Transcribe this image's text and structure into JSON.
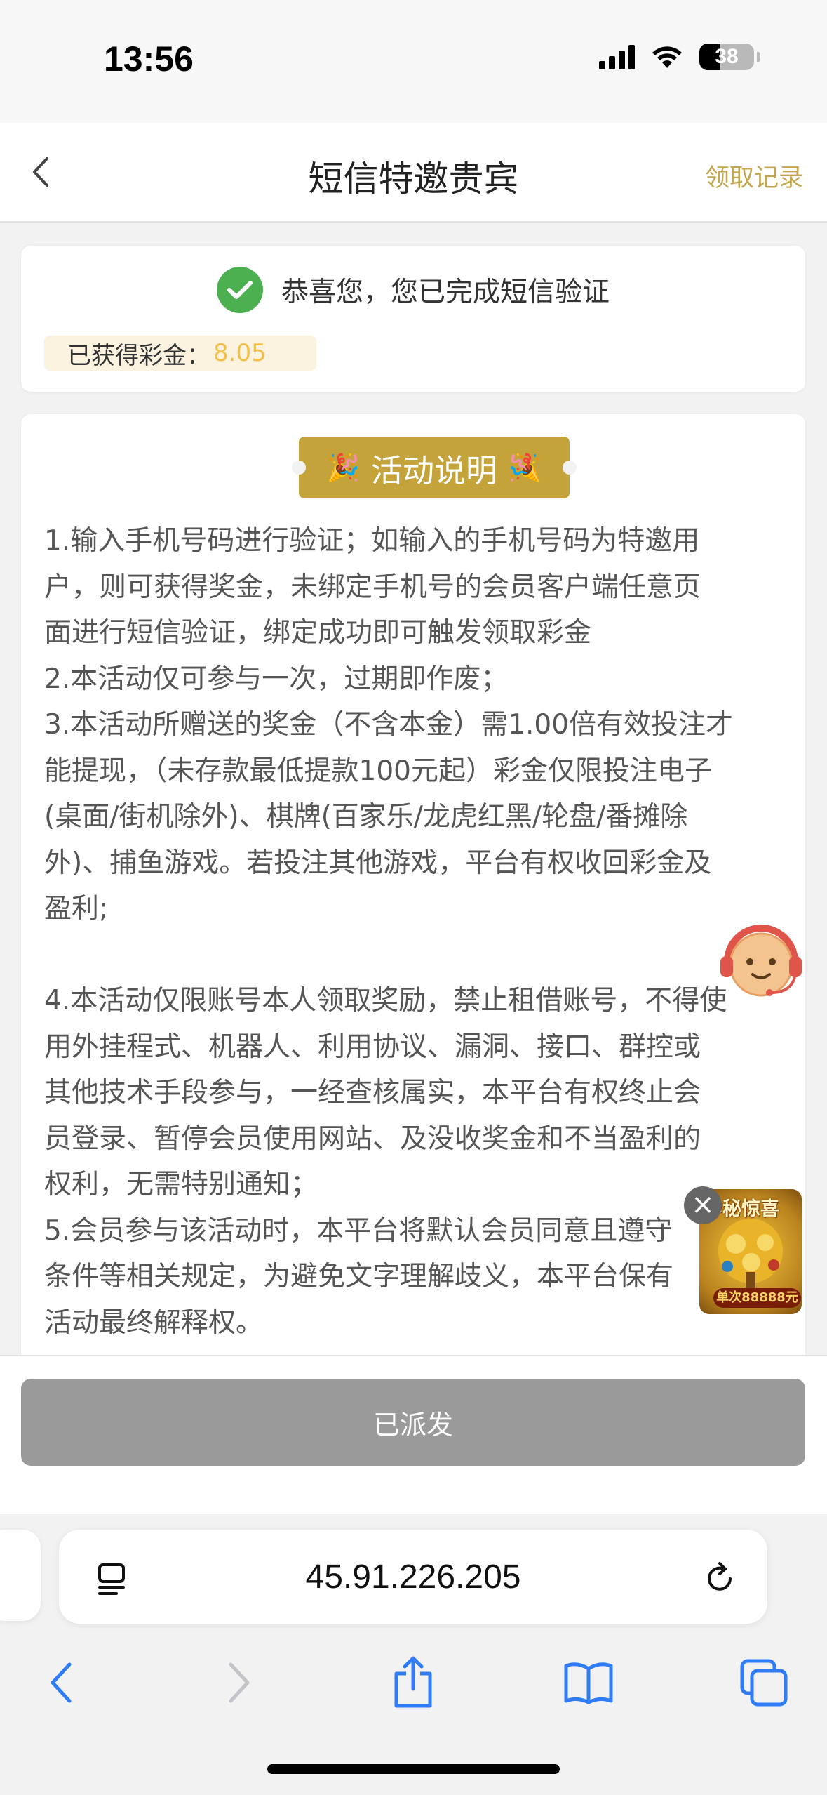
{
  "status_bar": {
    "time": "13:56",
    "battery": "38"
  },
  "nav": {
    "title": "短信特邀贵宾",
    "record_link": "领取记录"
  },
  "success": {
    "message": "恭喜您，您已完成短信验证",
    "bonus_label": "已获得彩金：",
    "bonus_value": "8.05"
  },
  "activity": {
    "badge_label": "活动说明",
    "rules_text": "1.输入手机号码进行验证；如输入的手机号码为特邀用\n户，则可获得奖金，未绑定手机号的会员客户端任意页\n面进行短信验证，绑定成功即可触发领取彩金\n2.本活动仅可参与一次，过期即作废；\n3.本活动所赠送的奖金（不含本金）需1.00倍有效投注才\n能提现，（未存款最低提款100元起）彩金仅限投注电子\n(桌面/街机除外)、棋牌(百家乐/龙虎红黑/轮盘/番摊除\n外)、捕鱼游戏。若投注其他游戏，平台有权收回彩金及\n盈利;\n\n4.本活动仅限账号本人领取奖励，禁止租借账号，不得使\n用外挂程式、机器人、利用协议、漏洞、接口、群控或\n其他技术手段参与，一经查核属实，本平台有权终止会\n员登录、暂停会员使用网站、及没收奖金和不当盈利的\n权利，无需特别通知；\n5.会员参与该活动时，本平台将默认会员同意且遵守\n条件等相关规定，为避免文字理解歧义，本平台保有\n活动最终解释权。"
  },
  "floating_gift": {
    "title": "神秘惊喜",
    "subtitle": "单次88888元"
  },
  "action": {
    "dispatch_label": "已派发"
  },
  "browser": {
    "url": "45.91.226.205"
  },
  "colors": {
    "accent_gold": "#c4a33a",
    "success_green": "#4caf50",
    "ios_blue": "#2f7cf6",
    "disabled_gray": "#9a9a9a"
  }
}
